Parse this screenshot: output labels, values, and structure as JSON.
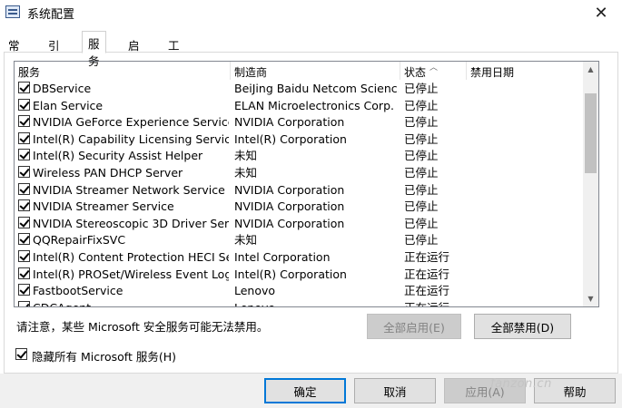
{
  "window": {
    "title": "系统配置"
  },
  "tabs": [
    {
      "label": "常规"
    },
    {
      "label": "引导"
    },
    {
      "label": "服务"
    },
    {
      "label": "启动"
    },
    {
      "label": "工具"
    }
  ],
  "table": {
    "columns": {
      "service": "服务",
      "maker": "制造商",
      "status": "状态",
      "disabled_date": "禁用日期"
    },
    "rows": [
      {
        "name": "DBService",
        "maker": "BeiJing Baidu Netcom Scienc...",
        "status": "已停止",
        "checked": true
      },
      {
        "name": "Elan Service",
        "maker": "ELAN Microelectronics Corp.",
        "status": "已停止",
        "checked": true
      },
      {
        "name": "NVIDIA GeForce Experience Service",
        "maker": "NVIDIA Corporation",
        "status": "已停止",
        "checked": true
      },
      {
        "name": "Intel(R) Capability Licensing Service ...",
        "maker": "Intel(R) Corporation",
        "status": "已停止",
        "checked": true
      },
      {
        "name": "Intel(R) Security Assist Helper",
        "maker": "未知",
        "status": "已停止",
        "checked": true
      },
      {
        "name": "Wireless PAN DHCP Server",
        "maker": "未知",
        "status": "已停止",
        "checked": true
      },
      {
        "name": "NVIDIA Streamer Network Service",
        "maker": "NVIDIA Corporation",
        "status": "已停止",
        "checked": true
      },
      {
        "name": "NVIDIA Streamer Service",
        "maker": "NVIDIA Corporation",
        "status": "已停止",
        "checked": true
      },
      {
        "name": "NVIDIA Stereoscopic 3D Driver Servi...",
        "maker": "NVIDIA Corporation",
        "status": "已停止",
        "checked": true
      },
      {
        "name": "QQRepairFixSVC",
        "maker": "未知",
        "status": "已停止",
        "checked": true
      },
      {
        "name": "Intel(R) Content Protection HECI Ser...",
        "maker": "Intel Corporation",
        "status": "正在运行",
        "checked": true
      },
      {
        "name": "Intel(R) PROSet/Wireless Event Log",
        "maker": "Intel(R) Corporation",
        "status": "正在运行",
        "checked": true
      },
      {
        "name": "FastbootService",
        "maker": "Lenovo",
        "status": "正在运行",
        "checked": true
      },
      {
        "name": "CDCAgent",
        "maker": "Lenovo",
        "status": "正在运行",
        "checked": true
      }
    ]
  },
  "note": "请注意，某些 Microsoft 安全服务可能无法禁用。",
  "buttons": {
    "enable_all": "全部启用(E)",
    "disable_all": "全部禁用(D)",
    "ok": "确定",
    "cancel": "取消",
    "apply": "应用(A)",
    "help": "帮助"
  },
  "hide_microsoft": {
    "label": "隐藏所有 Microsoft 服务(H)",
    "checked": true
  },
  "watermark": "fanzon.cn"
}
